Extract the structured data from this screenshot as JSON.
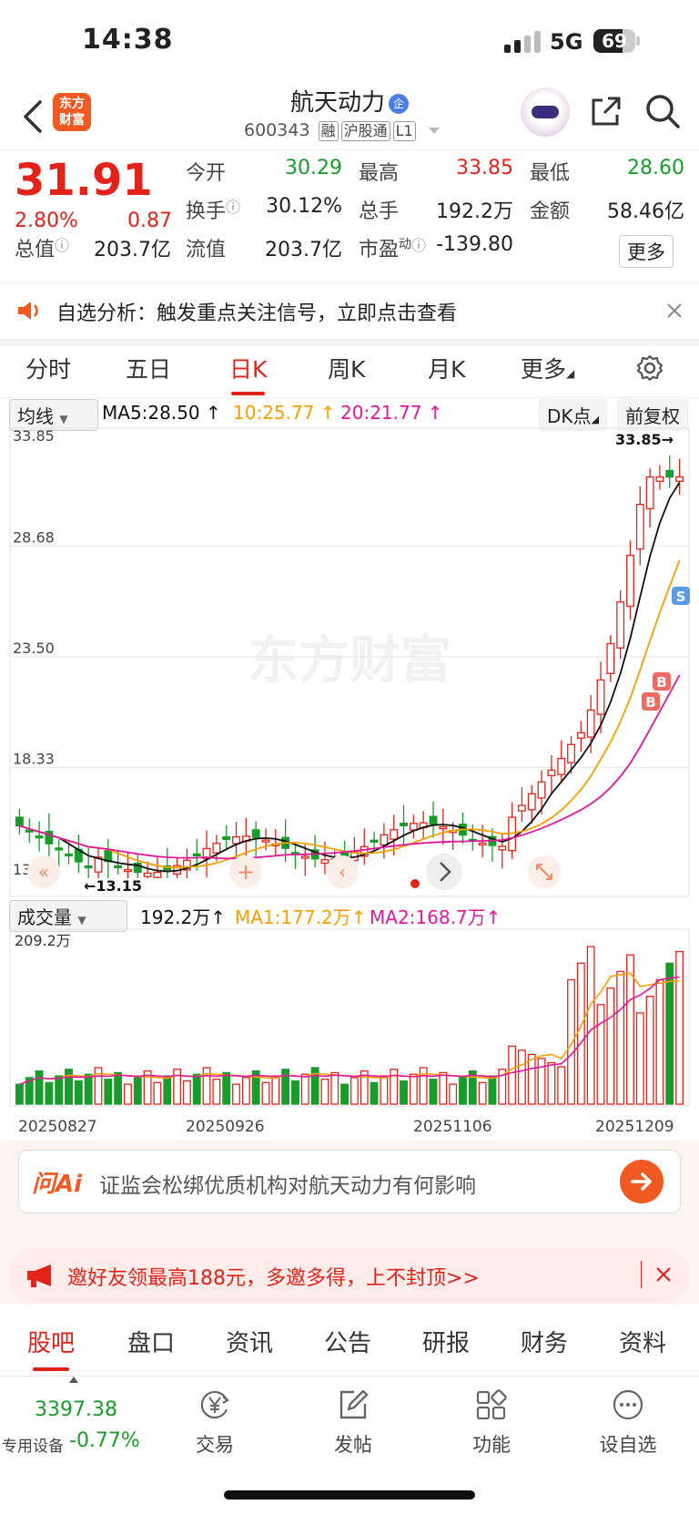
{
  "status_bar": {
    "time": "14:38",
    "network": "5G",
    "battery": "69",
    "battery_level": 0.69
  },
  "header": {
    "back_icon": "chevron-left-icon",
    "logo_line1": "东方",
    "logo_line2": "财富",
    "title": "航天动力",
    "title_badge": "企",
    "code": "600343",
    "tags": [
      "融",
      "沪股通",
      "L1"
    ]
  },
  "quote": {
    "price": "31.91",
    "change_pct": "2.80%",
    "change": "0.87",
    "open_label": "今开",
    "open": "30.29",
    "high_label": "最高",
    "high": "33.85",
    "low_label": "最低",
    "low": "28.60",
    "turnover_label": "换手",
    "turnover": "30.12%",
    "volume_label": "总手",
    "volume": "192.2万",
    "amount_label": "金额",
    "amount": "58.46亿",
    "total_cap_label": "总值",
    "total_cap": "203.7亿",
    "float_cap_label": "流值",
    "float_cap": "203.7亿",
    "pe_label": "市盈",
    "pe_sup": "动",
    "pe": "-139.80",
    "more": "更多"
  },
  "banner": {
    "text": "自选分析：触发重点关注信号，立即点击查看"
  },
  "chart_tabs": [
    "分时",
    "五日",
    "日K",
    "周K",
    "月K",
    "更多"
  ],
  "chart_tabs_active": 2,
  "ma_bar": {
    "selector": "均线",
    "ma5": "MA5:28.50",
    "ma10": "10:25.77",
    "ma20": "20:21.77",
    "dk": "DK点",
    "fq": "前复权"
  },
  "vol_bar": {
    "selector": "成交量",
    "vol": "192.2万",
    "ma1": "MA1:177.2万",
    "ma2": "MA2:168.7万"
  },
  "colors": {
    "up": "#e2231a",
    "down": "#1a9c2c",
    "ma5": "#111111",
    "ma10": "#f5a000",
    "ma20": "#e0189a"
  },
  "chart_data": {
    "type": "candlestick",
    "watermark": "东方财富",
    "price_axis": {
      "ticks": [
        "33.85",
        "28.68",
        "23.50",
        "18.33",
        "13.15"
      ],
      "ylim": [
        13.15,
        33.85
      ]
    },
    "high_label": "33.85→",
    "low_label": "←13.15",
    "volume_axis_max": "209.2万",
    "date_labels": [
      "20250827",
      "20250926",
      "20251106",
      "20251209"
    ],
    "markers": [
      "B",
      "B",
      "S"
    ]
  },
  "ai": {
    "label": "问Ai",
    "question": "证监会松绑优质机构对航天动力有何影响"
  },
  "promo": {
    "text": "邀好友领最高188元，多邀多得，上不封顶>>"
  },
  "info_tabs": [
    "股吧",
    "盘口",
    "资讯",
    "公告",
    "研报",
    "财务",
    "资料"
  ],
  "info_tabs_active": 0,
  "bottom": {
    "index_value": "3397.38",
    "index_name": "专用设备",
    "index_change": "-0.77%",
    "trade": "交易",
    "post": "发帖",
    "func": "功能",
    "watch": "设自选"
  }
}
